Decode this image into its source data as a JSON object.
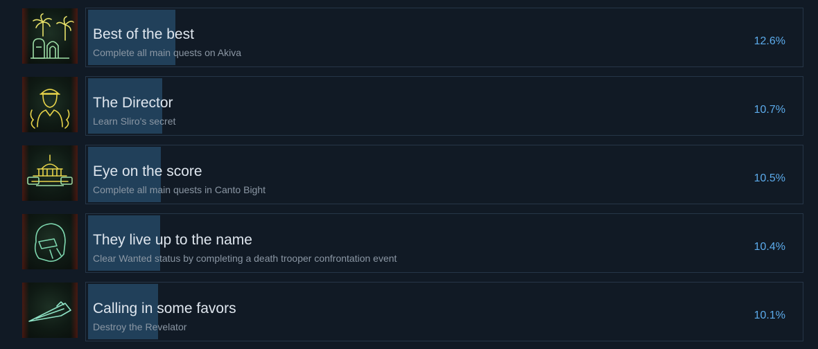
{
  "achievements": [
    {
      "title": "Best of the best",
      "description": "Complete all main quests on Akiva",
      "percent": "12.6%",
      "progress_fraction": 0.126,
      "icon": "palm-trees-hut-icon",
      "icon_color": "#e8e26a"
    },
    {
      "title": "The Director",
      "description": "Learn Sliro's secret",
      "percent": "10.7%",
      "progress_fraction": 0.107,
      "icon": "director-figure-icon",
      "icon_color": "#e8d44a"
    },
    {
      "title": "Eye on the score",
      "description": "Complete all main quests in Canto Bight",
      "percent": "10.5%",
      "progress_fraction": 0.105,
      "icon": "casino-building-icon",
      "icon_color": "#e8d44a"
    },
    {
      "title": "They live up to the name",
      "description": "Clear Wanted status by completing a death trooper confrontation event",
      "percent": "10.4%",
      "progress_fraction": 0.104,
      "icon": "death-trooper-helmet-icon",
      "icon_color": "#7fd9b0"
    },
    {
      "title": "Calling in some favors",
      "description": "Destroy the Revelator",
      "percent": "10.1%",
      "progress_fraction": 0.101,
      "icon": "star-destroyer-icon",
      "icon_color": "#8fe3c6"
    }
  ],
  "colors": {
    "background": "#111a25",
    "card_border": "#263648",
    "progress_fill": "#21405a",
    "title_text": "#dfe6ee",
    "description_text": "#8b97a4",
    "percent_text": "#5cabeb"
  }
}
